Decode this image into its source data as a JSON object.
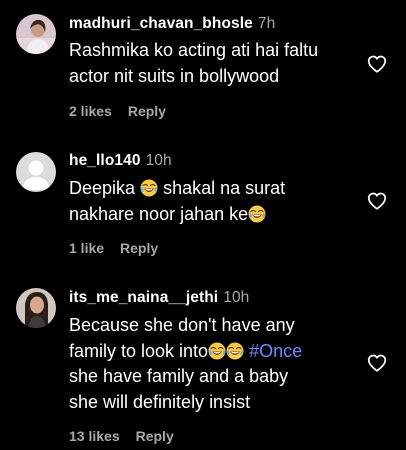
{
  "comments": [
    {
      "username": "madhuri_chavan_bhosle",
      "time": "7h",
      "lines": [
        "Rashmika ko acting ati hai faltu",
        "actor nit suits in bollywood"
      ],
      "likes": "2 likes",
      "reply": "Reply"
    },
    {
      "username": "he_llo140",
      "time": "10h",
      "line1": "Deepika",
      "line1b": "shakal na surat",
      "line2": "nakhare noor jahan ke",
      "likes": "1 like",
      "reply": "Reply"
    },
    {
      "username": "its_me_naina__jethi",
      "time": "10h",
      "line1": "Because she don't have any",
      "line2": "family to look into",
      "hashtag": "#Once",
      "line3": "she have family and a baby",
      "line4": "she will definitely insist",
      "likes": "13 likes",
      "reply": "Reply"
    }
  ],
  "icons": {
    "like": "heart-outline-icon",
    "emoji": "face-with-tears-of-joy-emoji"
  },
  "colors": {
    "background": "#000000",
    "text": "#ffffff",
    "secondary": "#a8a8a8",
    "hashtag": "#6f89ff"
  }
}
